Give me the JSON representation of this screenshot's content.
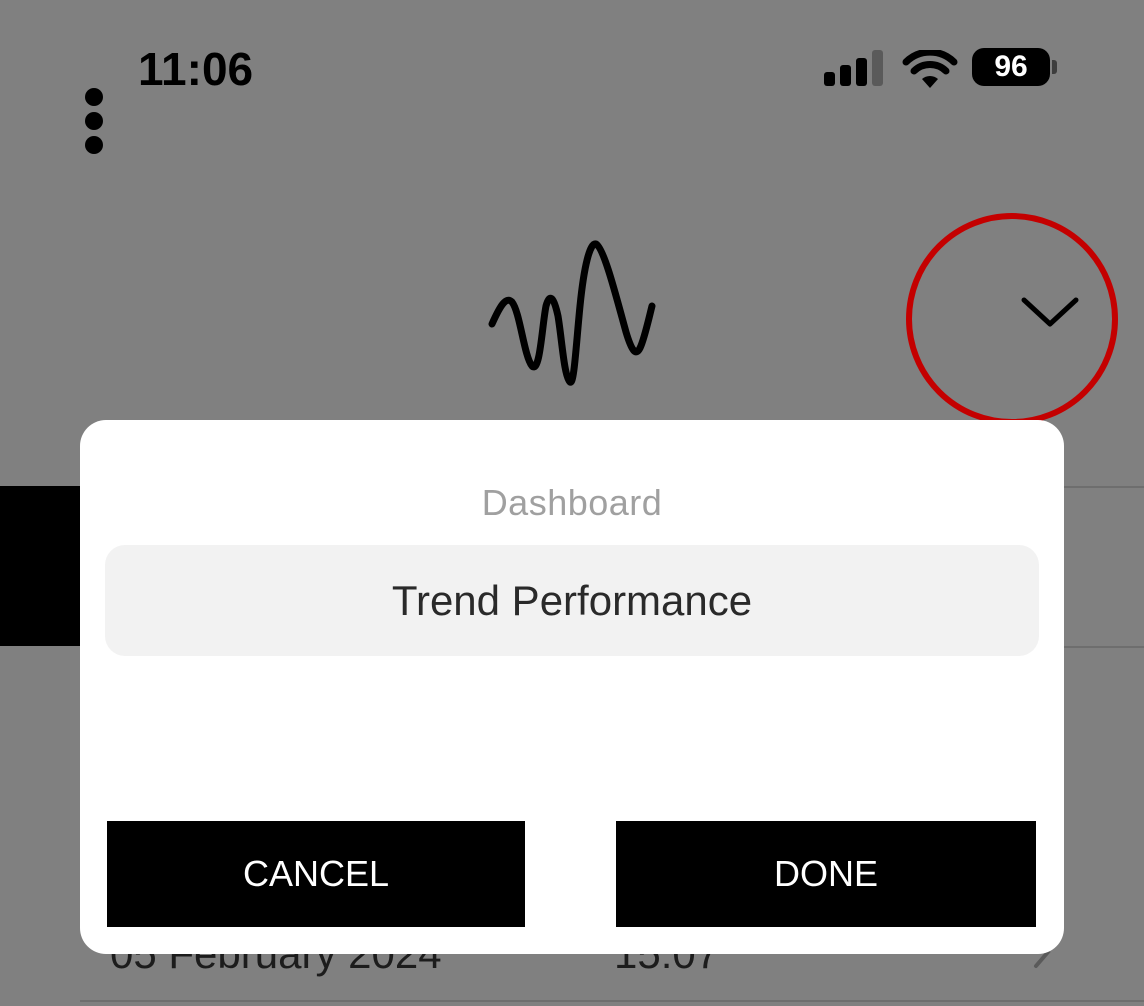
{
  "status_bar": {
    "time": "11:06",
    "battery": "96",
    "signal_icon": "cellular-signal-icon",
    "wifi_icon": "wifi-icon"
  },
  "header": {
    "menu_icon": "kebab-menu-icon",
    "logo_icon": "waveform-logo-icon",
    "dropdown_icon": "chevron-down-icon"
  },
  "background_list": {
    "row_date": "05 February 2024",
    "row_time": "15:07"
  },
  "dialog": {
    "title": "Dashboard",
    "options": [
      "Trend Performance"
    ],
    "cancel_label": "CANCEL",
    "done_label": "DONE"
  },
  "colors": {
    "overlay_gray": "#808080",
    "annotation_red": "#c40000",
    "button_black": "#000000",
    "option_background": "#f2f2f2"
  }
}
